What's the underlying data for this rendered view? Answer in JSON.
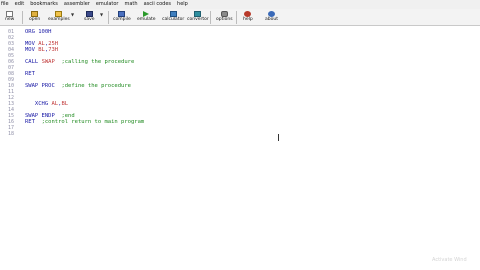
{
  "menu": [
    "file",
    "edit",
    "bookmarks",
    "assembler",
    "emulator",
    "math",
    "ascii codes",
    "help"
  ],
  "toolbar": {
    "new": "new",
    "open": "open",
    "examples": "examples",
    "save": "save",
    "compile": "compile",
    "emulate": "emulate",
    "calculator": "calculator",
    "convertor": "convertor",
    "options": "options",
    "help": "help",
    "about": "about"
  },
  "code": [
    {
      "n": "01",
      "parts": [
        [
          "kw",
          "ORG 100H"
        ]
      ]
    },
    {
      "n": "02",
      "parts": []
    },
    {
      "n": "03",
      "parts": [
        [
          "kw",
          "MOV "
        ],
        [
          "reg",
          "AL"
        ],
        [
          "kw",
          ","
        ],
        [
          "num",
          "25H"
        ]
      ]
    },
    {
      "n": "04",
      "parts": [
        [
          "kw",
          "MOV "
        ],
        [
          "reg",
          "BL"
        ],
        [
          "kw",
          ","
        ],
        [
          "num",
          "73H"
        ]
      ]
    },
    {
      "n": "05",
      "parts": []
    },
    {
      "n": "06",
      "parts": [
        [
          "kw",
          "CALL "
        ],
        [
          "reg",
          "SWAP"
        ],
        [
          "kw",
          "  "
        ],
        [
          "cmt",
          ";calling the procedure"
        ]
      ]
    },
    {
      "n": "07",
      "parts": []
    },
    {
      "n": "08",
      "parts": [
        [
          "kw",
          "RET"
        ]
      ]
    },
    {
      "n": "09",
      "parts": []
    },
    {
      "n": "10",
      "parts": [
        [
          "kw",
          "SWAP PROC  "
        ],
        [
          "cmt",
          ";define the procedure"
        ]
      ]
    },
    {
      "n": "11",
      "parts": []
    },
    {
      "n": "12",
      "parts": []
    },
    {
      "n": "13",
      "parts": [
        [
          "kw",
          "   XCHG "
        ],
        [
          "reg",
          "AL"
        ],
        [
          "kw",
          ","
        ],
        [
          "reg",
          "BL"
        ]
      ]
    },
    {
      "n": "14",
      "parts": []
    },
    {
      "n": "15",
      "parts": [
        [
          "kw",
          "SWAP ENDP  "
        ],
        [
          "cmt",
          ";end"
        ]
      ]
    },
    {
      "n": "16",
      "parts": [
        [
          "kw",
          "RET  "
        ],
        [
          "cmt",
          ";control return to main program"
        ]
      ]
    },
    {
      "n": "17",
      "parts": []
    },
    {
      "n": "18",
      "parts": []
    }
  ],
  "watermark": "Activate Wind"
}
